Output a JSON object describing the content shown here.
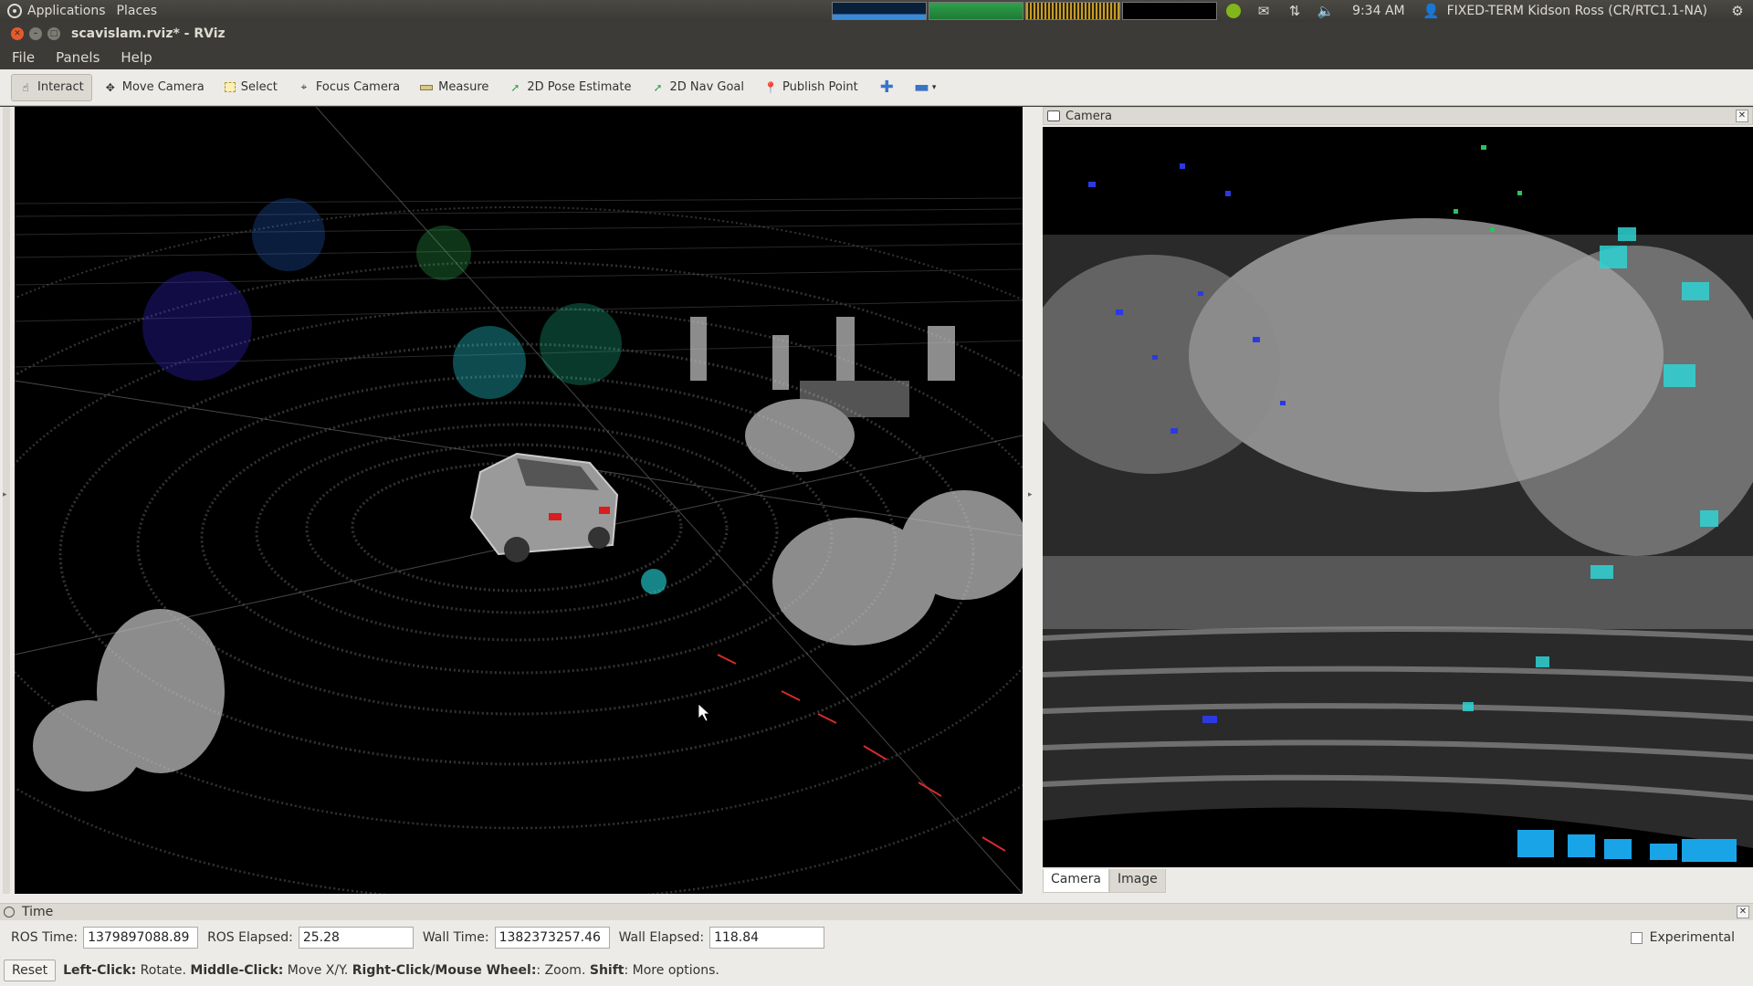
{
  "topbar": {
    "applications": "Applications",
    "places": "Places",
    "clock": "9:34 AM",
    "user": "FIXED-TERM Kidson Ross (CR/RTC1.1-NA)"
  },
  "window": {
    "title": "scavislam.rviz* - RViz"
  },
  "menu": {
    "file": "File",
    "panels": "Panels",
    "help": "Help"
  },
  "toolbar": {
    "interact": "Interact",
    "move_camera": "Move Camera",
    "select": "Select",
    "focus_camera": "Focus Camera",
    "measure": "Measure",
    "pose_estimate": "2D Pose Estimate",
    "nav_goal": "2D Nav Goal",
    "publish_point": "Publish Point"
  },
  "camera_panel": {
    "title": "Camera",
    "tabs": [
      "Camera",
      "Image"
    ]
  },
  "time_panel": {
    "title": "Time",
    "ros_time_label": "ROS Time:",
    "ros_time": "1379897088.89",
    "ros_elapsed_label": "ROS Elapsed:",
    "ros_elapsed": "25.28",
    "wall_time_label": "Wall Time:",
    "wall_time": "1382373257.46",
    "wall_elapsed_label": "Wall Elapsed:",
    "wall_elapsed": "118.84",
    "experimental": "Experimental"
  },
  "status": {
    "reset": "Reset",
    "h1": "Left-Click:",
    "t1": " Rotate. ",
    "h2": "Middle-Click:",
    "t2": " Move X/Y. ",
    "h3": "Right-Click/Mouse Wheel:",
    "t3": ": Zoom. ",
    "h4": "Shift",
    "t4": ": More options."
  },
  "colors": {
    "panel_bg": "#edebe7",
    "titlebar_bg": "#3c3b37",
    "accent_cyan": "#26c6da"
  }
}
